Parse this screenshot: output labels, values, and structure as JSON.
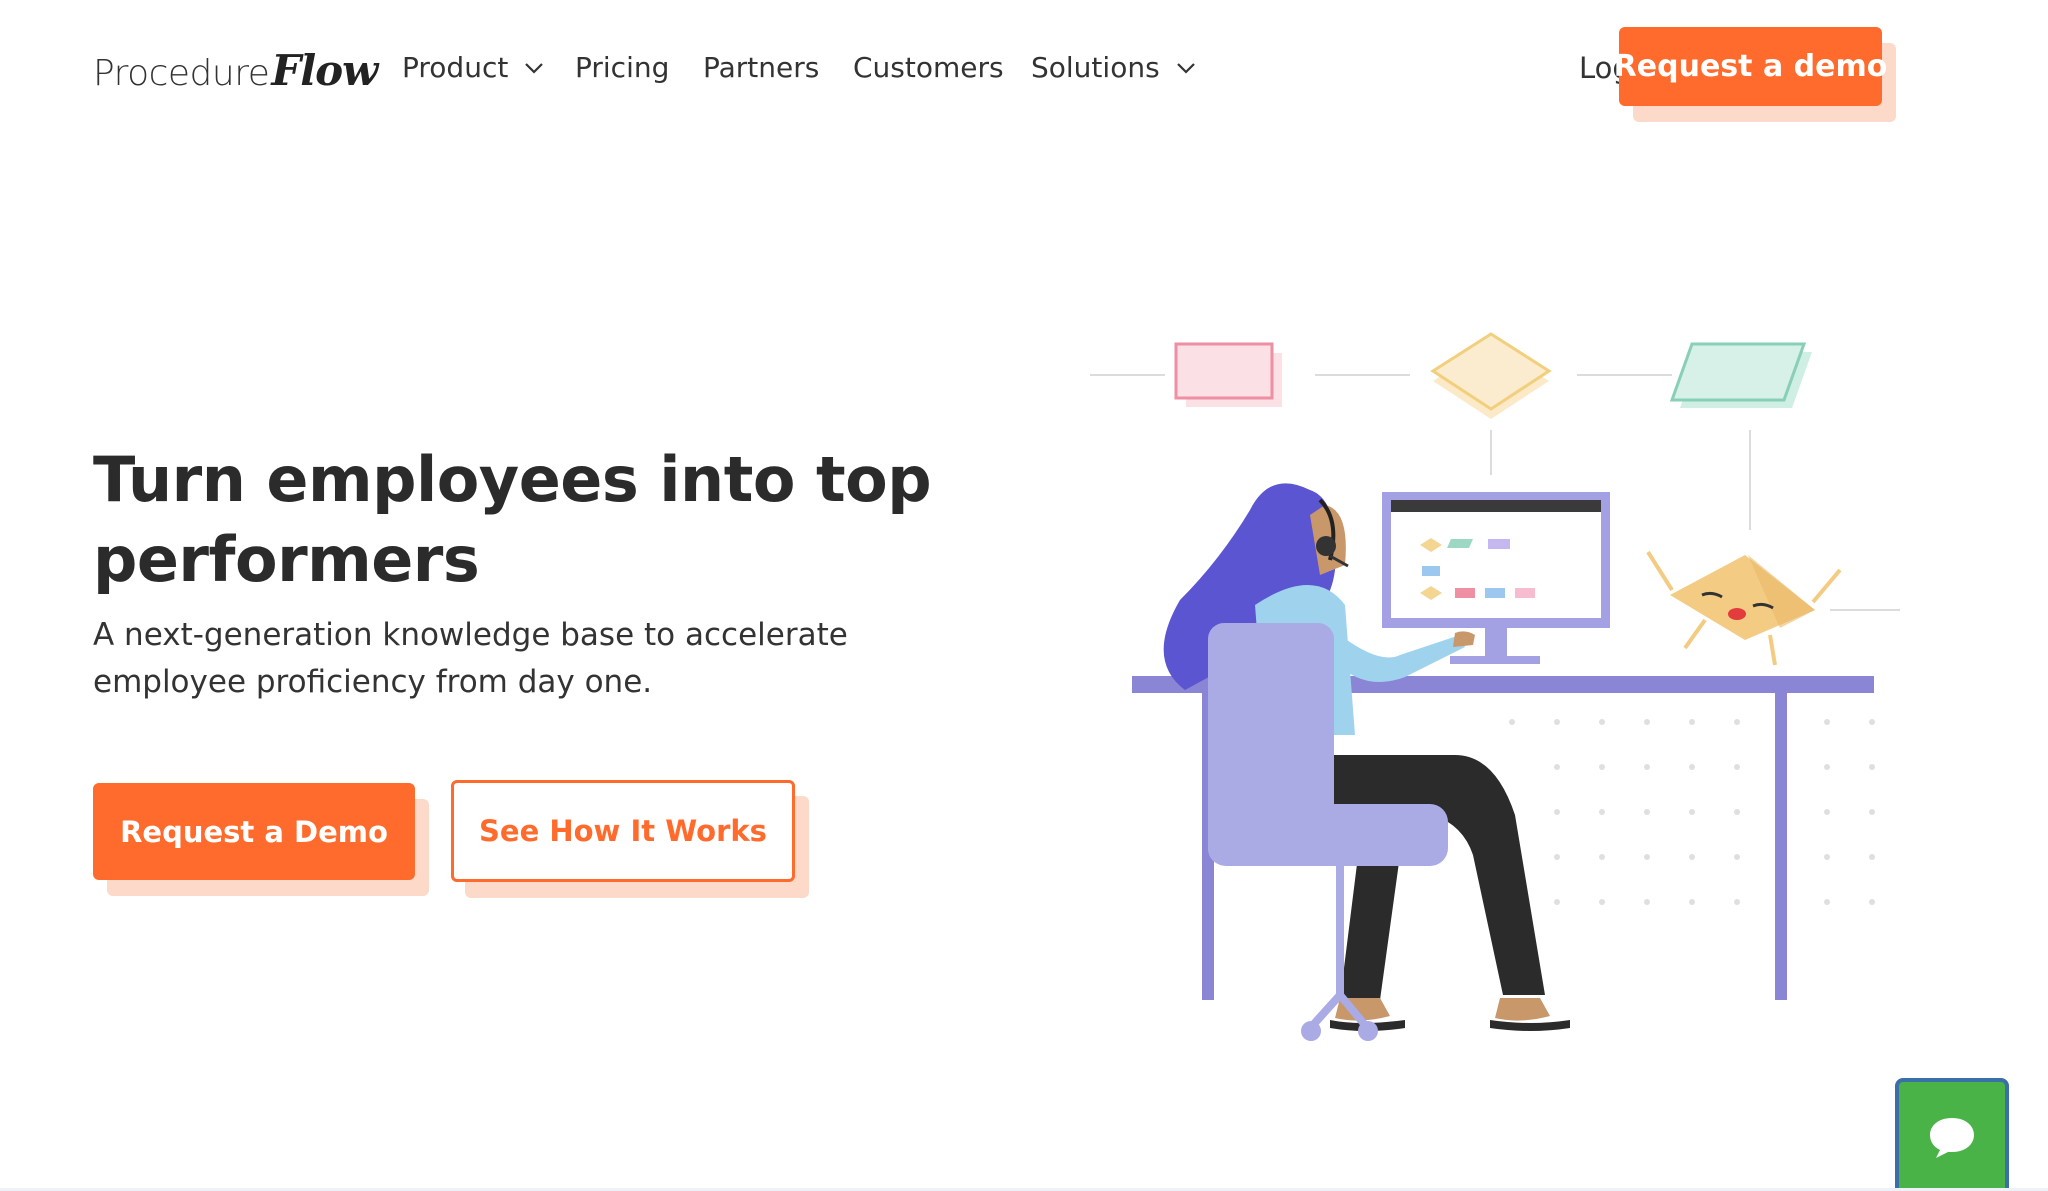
{
  "brand": {
    "logo_part1": "Procedure",
    "logo_part2": "Flow"
  },
  "nav": {
    "items": [
      {
        "label": "Product",
        "has_dropdown": true
      },
      {
        "label": "Pricing",
        "has_dropdown": false
      },
      {
        "label": "Partners",
        "has_dropdown": false
      },
      {
        "label": "Customers",
        "has_dropdown": false
      },
      {
        "label": "Solutions",
        "has_dropdown": true
      }
    ],
    "login": "Log in",
    "cta": "Request a demo"
  },
  "hero": {
    "title": "Turn employees into top performers",
    "subtitle": "A next-generation knowledge base to accelerate employee proficiency from day one.",
    "primary_button": "Request a Demo",
    "secondary_button": "See How It Works"
  },
  "illustration": {
    "name": "employee-at-desk-illustration",
    "icons": [
      "process-rectangle-icon",
      "decision-diamond-icon",
      "data-parallelogram-icon",
      "happy-diamond-mascot-icon"
    ]
  },
  "chat": {
    "icon": "chat-bubble-icon"
  },
  "colors": {
    "accent": "#ff6b2c",
    "accent_shadow": "#fdd9c9",
    "purple": "#8b85d6",
    "chat_green": "#49b348"
  }
}
